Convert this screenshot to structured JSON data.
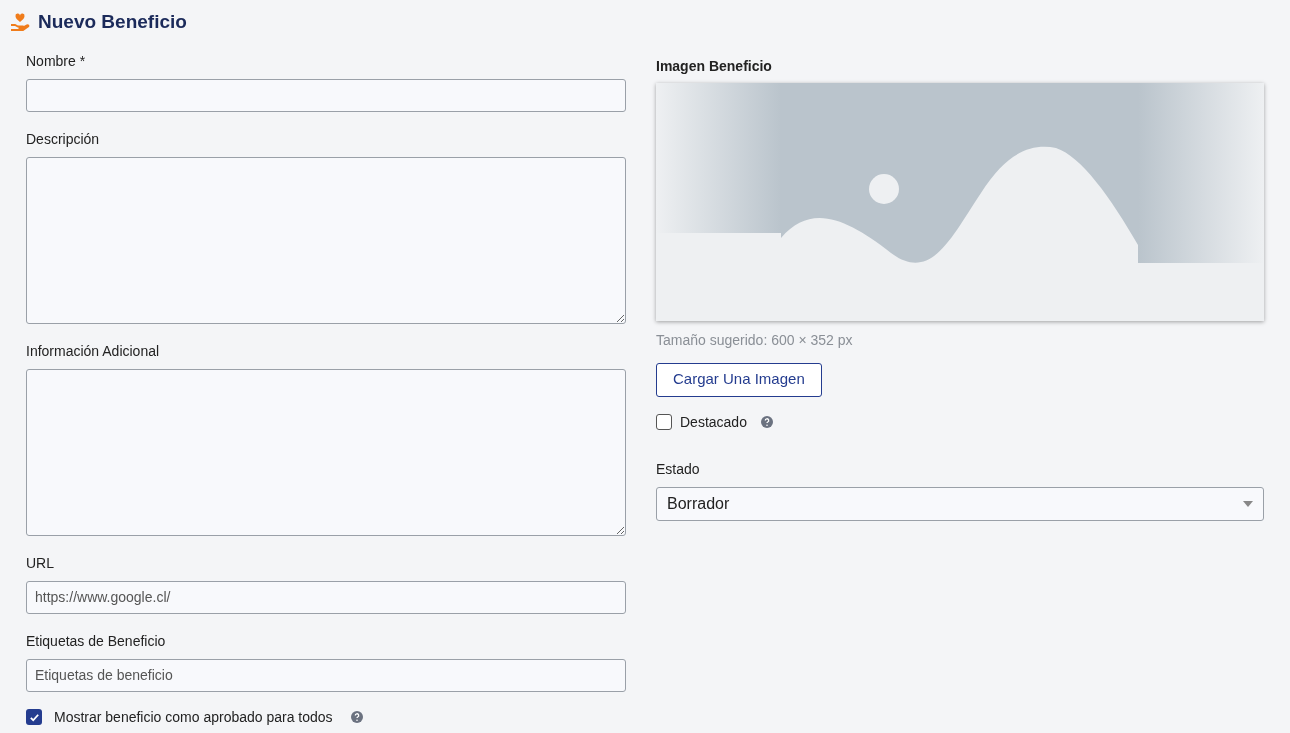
{
  "header": {
    "title": "Nuevo Beneficio"
  },
  "left_fields": [
    {
      "kind": "input",
      "label": "Nombre *"
    },
    {
      "kind": "textarea",
      "label": "Descripción"
    },
    {
      "kind": "textarea",
      "label": "Información Adicional"
    },
    {
      "kind": "input",
      "label": "URL",
      "value": "https://www.google.cl/"
    },
    {
      "kind": "input",
      "label": "Etiquetas de Beneficio",
      "placeholder": "Etiquetas de beneficio"
    }
  ],
  "approved_checkbox": {
    "label": "Mostrar beneficio como aprobado para todos",
    "checked": true
  },
  "image": {
    "label": "Imagen Beneficio",
    "hint": "Tamaño sugerido: 600 × 352 px",
    "button": "Cargar Una Imagen"
  },
  "featured_checkbox": {
    "label": "Destacado",
    "checked": false
  },
  "status": {
    "label": "Estado",
    "value": "Borrador"
  }
}
